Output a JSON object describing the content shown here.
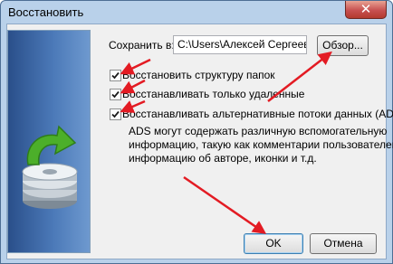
{
  "window": {
    "title": "Восстановить",
    "close_symbol": "✕"
  },
  "save": {
    "label": "Сохранить в:",
    "path_value": "C:\\Users\\Алексей Сергеевич\\V",
    "browse_label": "Обзор..."
  },
  "options": [
    {
      "label": "Восстановить структуру папок",
      "checked": true
    },
    {
      "label": "Восстанавливать только удаленные",
      "checked": true
    },
    {
      "label": "Восстанавливать альтернативные потоки данных (ADS)",
      "checked": true
    }
  ],
  "description": [
    "ADS могут содержать различную вспомогательную",
    "информацию, такую как комментарии пользователей,",
    "информацию об авторе, иконки и т.д."
  ],
  "buttons": {
    "ok_label": "OK",
    "cancel_label": "Отмена"
  },
  "icons": {
    "sidebar_graphic": "disk-restore-icon",
    "close": "close-icon"
  },
  "colors": {
    "annotation_arrow": "#e31b23",
    "sidebar": "#3c66a6",
    "restore_arrow": "#4caf2a"
  }
}
